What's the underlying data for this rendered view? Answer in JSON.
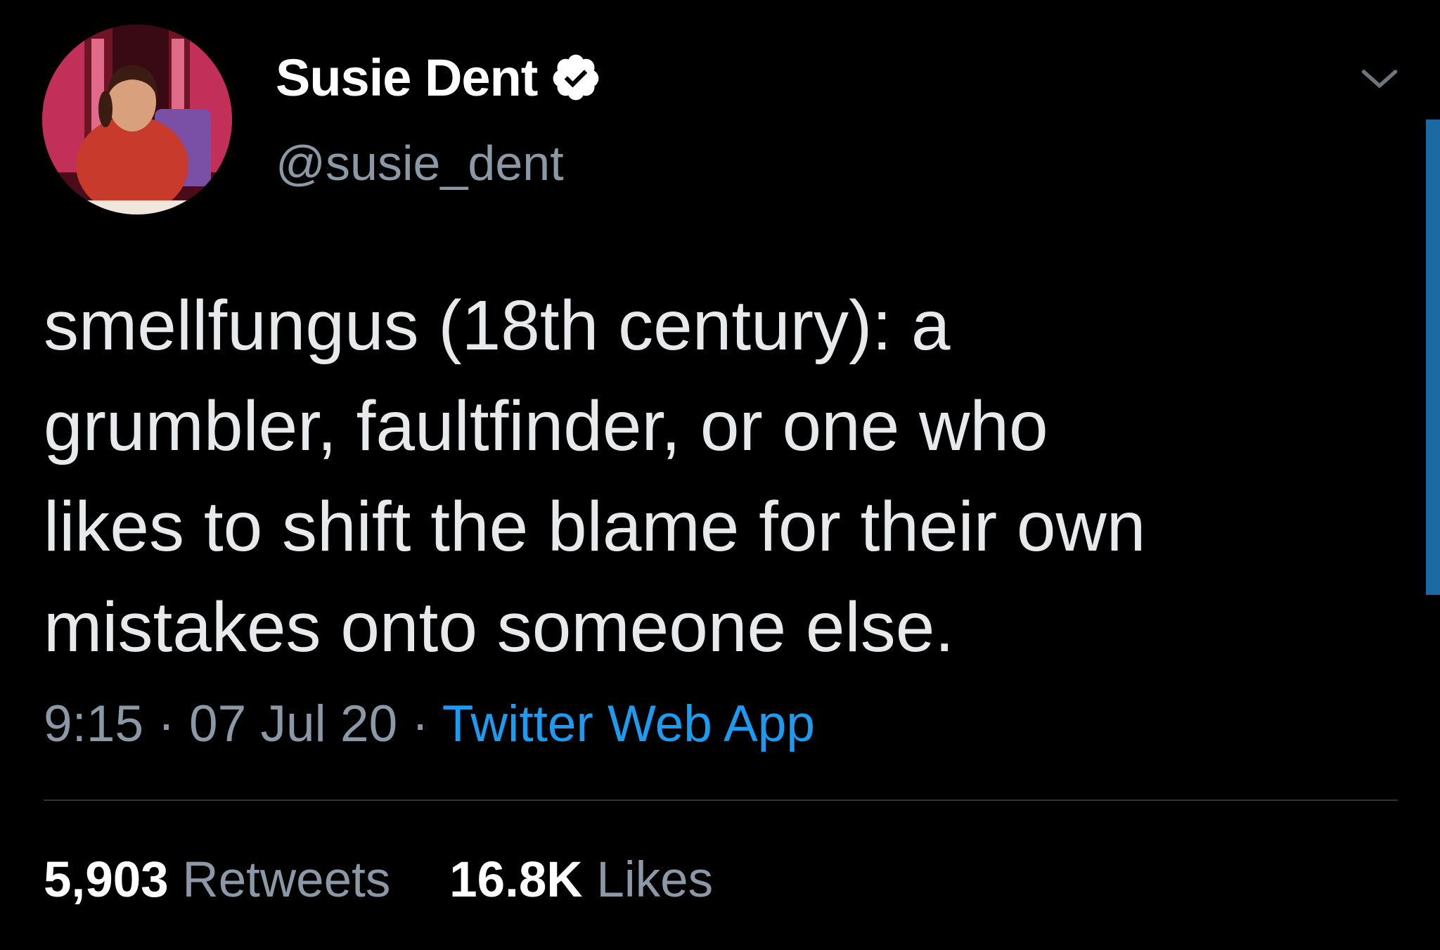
{
  "tweet": {
    "author": {
      "display_name": "Susie Dent",
      "handle": "@susie_dent",
      "verified": true
    },
    "text_lines": [
      "smellfungus (18th century): a",
      "grumbler, faultfinder, or one who",
      "likes to shift the blame for their own",
      "mistakes onto someone else."
    ],
    "meta": {
      "time": "9:15",
      "separator": " · ",
      "date": "07 Jul 20",
      "source": "Twitter Web App"
    },
    "stats": {
      "retweets_count": "5,903",
      "retweets_label": "Retweets",
      "likes_count": "16.8K",
      "likes_label": "Likes"
    }
  },
  "icons": {
    "verified": "verified-badge-icon",
    "menu": "chevron-down-icon"
  },
  "colors": {
    "background": "#000000",
    "text": "#e7e9ea",
    "secondary_text": "#8b98a5",
    "link": "#1d9bf0",
    "divider": "#2f3336"
  }
}
